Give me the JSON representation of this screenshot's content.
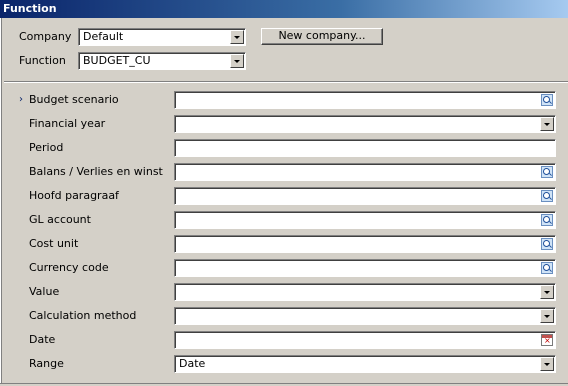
{
  "window": {
    "title": "Function"
  },
  "header": {
    "company_label": "Company",
    "company_value": "Default",
    "function_label": "Function",
    "function_value": "BUDGET_CU",
    "new_company_button": "New company..."
  },
  "form": {
    "required_marker": "›",
    "fields": [
      {
        "label": "Budget scenario",
        "value": "",
        "control": "zoom",
        "required": true
      },
      {
        "label": "Financial year",
        "value": "",
        "control": "dropdown"
      },
      {
        "label": "Period",
        "value": "",
        "control": "text"
      },
      {
        "label": "Balans / Verlies en winst",
        "value": "",
        "control": "zoom"
      },
      {
        "label": "Hoofd paragraaf",
        "value": "",
        "control": "zoom"
      },
      {
        "label": "GL account",
        "value": "",
        "control": "zoom"
      },
      {
        "label": "Cost unit",
        "value": "",
        "control": "zoom"
      },
      {
        "label": "Currency code",
        "value": "",
        "control": "zoom"
      },
      {
        "label": "Value",
        "value": "",
        "control": "dropdown"
      },
      {
        "label": "Calculation method",
        "value": "",
        "control": "dropdown"
      },
      {
        "label": "Date",
        "value": "",
        "control": "calendar"
      },
      {
        "label": "Range",
        "value": "Date",
        "control": "dropdown"
      }
    ]
  },
  "icons": {
    "zoom": "lookup-zoom-icon",
    "dropdown": "chevron-down-icon",
    "calendar": "calendar-icon"
  }
}
